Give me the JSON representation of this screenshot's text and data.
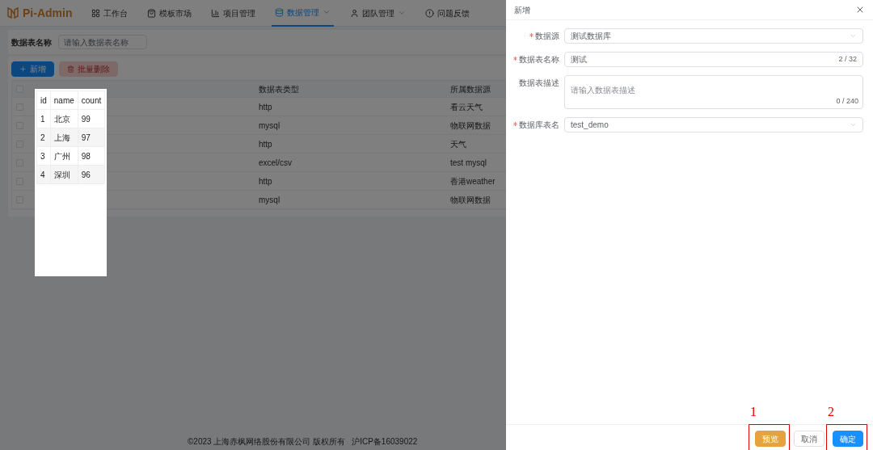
{
  "nav": {
    "logo": "Pi-Admin",
    "items": [
      {
        "label": "工作台",
        "selected": false,
        "dropdown": false
      },
      {
        "label": "模板市场",
        "selected": false,
        "dropdown": false
      },
      {
        "label": "项目管理",
        "selected": false,
        "dropdown": false
      },
      {
        "label": "数据管理",
        "selected": true,
        "dropdown": true
      },
      {
        "label": "团队管理",
        "selected": false,
        "dropdown": true
      },
      {
        "label": "问题反馈",
        "selected": false,
        "dropdown": false
      }
    ]
  },
  "search": {
    "label": "数据表名称",
    "placeholder": "请输入数据表名称"
  },
  "toolbar": [
    {
      "label": "新增",
      "kind": "primary",
      "disabled": false
    },
    {
      "label": "批量删除",
      "kind": "danger",
      "disabled": true
    }
  ],
  "table": {
    "header_checked": false,
    "columns": [
      "数据表类型",
      "所属数据源"
    ],
    "rows": [
      {
        "checked": false,
        "type": "http",
        "source": "看云天气"
      },
      {
        "checked": false,
        "type": "mysql",
        "source": "物联网数据"
      },
      {
        "checked": false,
        "type": "http",
        "source": "天气"
      },
      {
        "checked": false,
        "type": "excel/csv",
        "source": "test mysql"
      },
      {
        "checked": false,
        "type": "http",
        "source": "香港weather"
      },
      {
        "checked": false,
        "type": "mysql",
        "source": "物联网数据"
      }
    ]
  },
  "preview": {
    "columns": [
      "id",
      "name",
      "count"
    ],
    "rows": [
      [
        "1",
        "北京",
        "99"
      ],
      [
        "2",
        "上海",
        "97"
      ],
      [
        "3",
        "广州",
        "98"
      ],
      [
        "4",
        "深圳",
        "96"
      ]
    ]
  },
  "footer": [
    "©2023 上海赤枫网络股份有限公司 版权所有",
    "沪ICP备16039022"
  ],
  "drawer": {
    "title": "新增",
    "fields": [
      {
        "kind": "select",
        "label": "数据源",
        "required": true,
        "value": "测试数据库"
      },
      {
        "kind": "input",
        "label": "数据表名称",
        "required": true,
        "value": "测试",
        "count": "2 / 32"
      },
      {
        "kind": "textarea",
        "label": "数据表描述",
        "required": false,
        "placeholder": "请输入数据表描述",
        "count": "0 / 240"
      },
      {
        "kind": "select",
        "label": "数据库表名",
        "required": true,
        "value": "test_demo"
      }
    ],
    "buttons": [
      {
        "label": "预览",
        "kind": "warning",
        "annotation": "1"
      },
      {
        "label": "取消",
        "kind": "default"
      },
      {
        "label": "确定",
        "kind": "primary",
        "annotation": "2"
      }
    ]
  }
}
